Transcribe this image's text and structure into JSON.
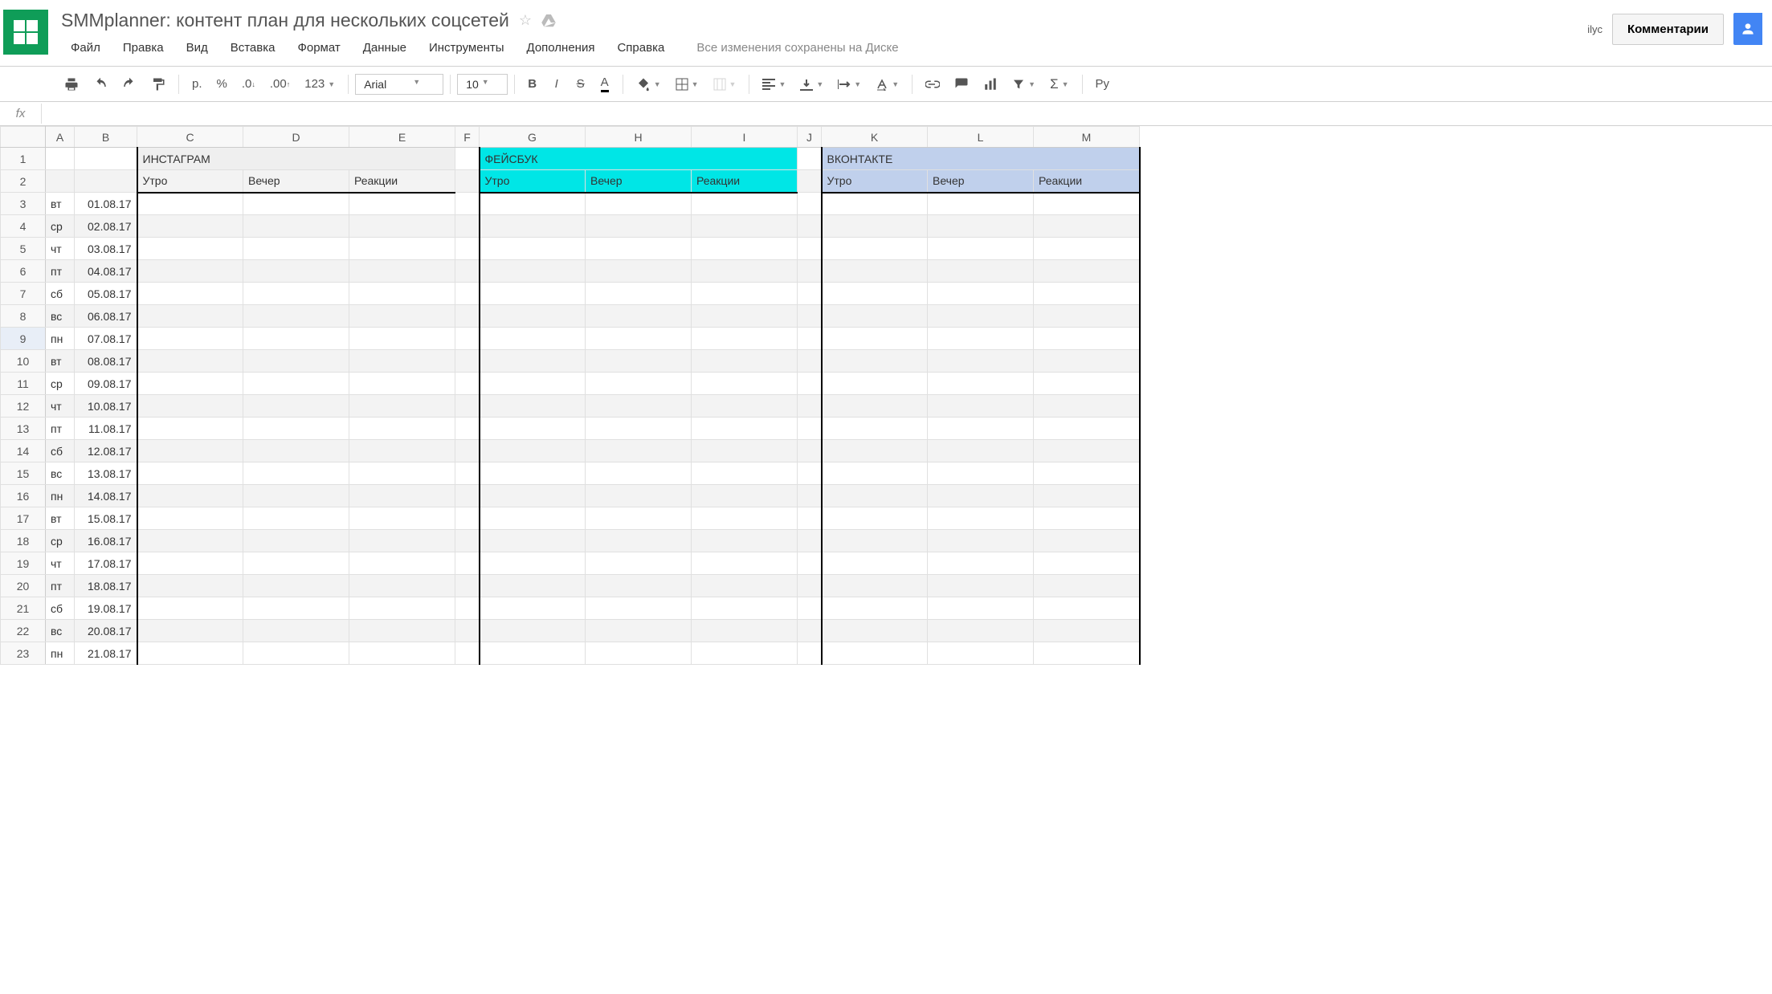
{
  "doc": {
    "title": "SMMplanner: контент план для нескольких соцсетей"
  },
  "user": {
    "label": "ilyc"
  },
  "buttons": {
    "comments": "Комментарии"
  },
  "menu": [
    "Файл",
    "Правка",
    "Вид",
    "Вставка",
    "Формат",
    "Данные",
    "Инструменты",
    "Дополнения",
    "Справка"
  ],
  "save_status": "Все изменения сохранены на Диске",
  "toolbar": {
    "currency": "р.",
    "percent": "%",
    "dec_dec": ".0",
    "dec_inc": ".00",
    "more_formats": "123",
    "font": "Arial",
    "size": "10",
    "addon": "Ру"
  },
  "formula": {
    "fx": "fx",
    "value": ""
  },
  "columns": [
    "A",
    "B",
    "C",
    "D",
    "E",
    "F",
    "G",
    "H",
    "I",
    "J",
    "K",
    "L",
    "M"
  ],
  "row_numbers": [
    "1",
    "2",
    "3",
    "4",
    "5",
    "6",
    "7",
    "8",
    "9",
    "10",
    "11",
    "12",
    "13",
    "14",
    "15",
    "16",
    "17",
    "18",
    "19",
    "20",
    "21",
    "22",
    "23"
  ],
  "headers": {
    "instagram": "ИНСТАГРАМ",
    "facebook": "ФЕЙСБУК",
    "vk": "ВКОНТАКТЕ",
    "morning": "Утро",
    "evening": "Вечер",
    "reactions": "Реакции"
  },
  "rows": [
    {
      "day": "вт",
      "date": "01.08.17"
    },
    {
      "day": "ср",
      "date": "02.08.17"
    },
    {
      "day": "чт",
      "date": "03.08.17"
    },
    {
      "day": "пт",
      "date": "04.08.17"
    },
    {
      "day": "сб",
      "date": "05.08.17"
    },
    {
      "day": "вс",
      "date": "06.08.17"
    },
    {
      "day": "пн",
      "date": "07.08.17"
    },
    {
      "day": "вт",
      "date": "08.08.17"
    },
    {
      "day": "ср",
      "date": "09.08.17"
    },
    {
      "day": "чт",
      "date": "10.08.17"
    },
    {
      "day": "пт",
      "date": "11.08.17"
    },
    {
      "day": "сб",
      "date": "12.08.17"
    },
    {
      "day": "вс",
      "date": "13.08.17"
    },
    {
      "day": "пн",
      "date": "14.08.17"
    },
    {
      "day": "вт",
      "date": "15.08.17"
    },
    {
      "day": "ср",
      "date": "16.08.17"
    },
    {
      "day": "чт",
      "date": "17.08.17"
    },
    {
      "day": "пт",
      "date": "18.08.17"
    },
    {
      "day": "сб",
      "date": "19.08.17"
    },
    {
      "day": "вс",
      "date": "20.08.17"
    },
    {
      "day": "пн",
      "date": "21.08.17"
    }
  ],
  "selected_row": 9
}
